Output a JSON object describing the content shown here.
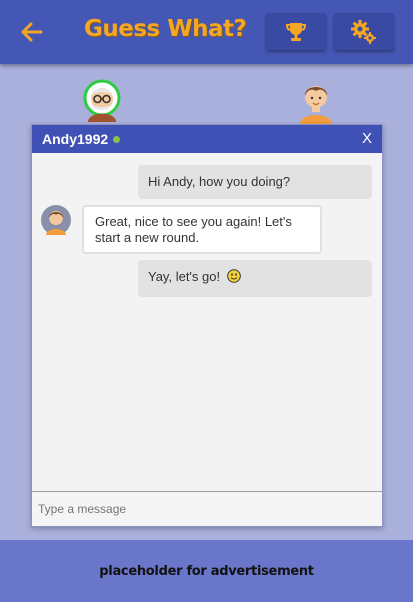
{
  "header": {
    "title": "Guess What?",
    "back_icon": "arrow-left-icon",
    "trophy_icon": "trophy-icon",
    "settings_icon": "gears-icon",
    "accent_color": "#f5a623",
    "bar_color": "#4557b5"
  },
  "players": {
    "left_avatar_icon": "grandpa-avatar-icon",
    "right_avatar_icon": "boy-avatar-icon"
  },
  "chat": {
    "contact_name": "Andy1992",
    "online_status_color": "#8bc34a",
    "close_label": "X",
    "messages": [
      {
        "direction": "outgoing",
        "text": "Hi Andy, how you doing?"
      },
      {
        "direction": "incoming",
        "text": "Great, nice to see you again! Let's start a new round."
      },
      {
        "direction": "outgoing",
        "text": "Yay, let's go!",
        "emoji": "smiley-icon"
      }
    ],
    "input_placeholder": "Type a message"
  },
  "ad": {
    "text": "placeholder for advertisement"
  }
}
